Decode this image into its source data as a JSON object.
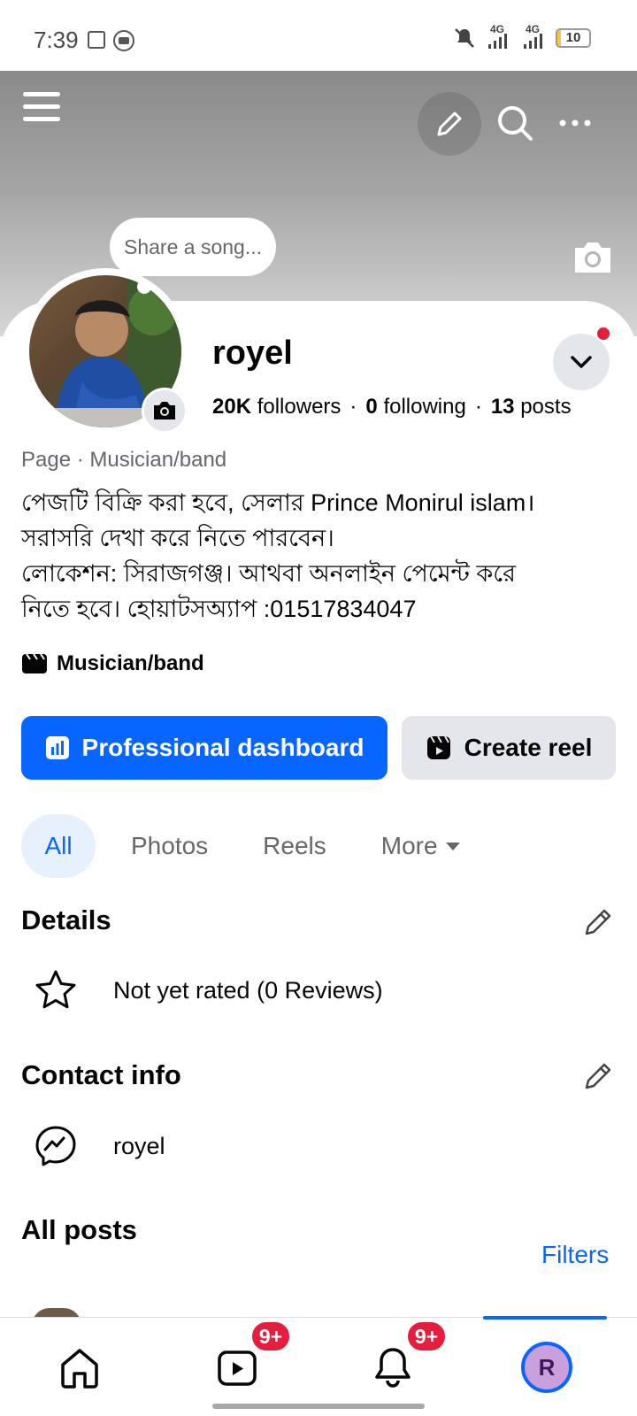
{
  "status_bar": {
    "time": "7:39",
    "network_1": "4G",
    "network_2": "4G",
    "battery_level": "10",
    "battery_percent": 10
  },
  "cover": {
    "song_prompt": "Share a song..."
  },
  "profile": {
    "name": "royel",
    "followers_count": "20K",
    "followers_label": "followers",
    "following_count": "0",
    "following_label": "following",
    "posts_count": "13",
    "posts_label": "posts",
    "stat_separator": "·",
    "page_category_line": "Page · Musician/band",
    "bio_lines": [
      "পেজটি বিক্রি করা হবে, সেলার Prince Monirul islam।",
      "সরাসরি দেখা করে নিতে পারবেন।",
      "লোকেশন: সিরাজগঞ্জ। আথবা অনলাইন পেমেন্ট করে",
      "নিতে হবে। হোয়াটসঅ্যাপ :01517834047"
    ],
    "category": "Musician/band"
  },
  "actions": {
    "primary_label": "Professional dashboard",
    "secondary_label": "Create reel"
  },
  "tabs": [
    "All",
    "Photos",
    "Reels",
    "More"
  ],
  "details": {
    "title": "Details",
    "rating_text": "Not yet rated (0 Reviews)"
  },
  "contact": {
    "title": "Contact info",
    "messenger": "royel"
  },
  "posts": {
    "title": "All posts",
    "filters_label": "Filters"
  },
  "bottom_nav": {
    "video_badge": "9+",
    "notif_badge": "9+",
    "avatar_letter": "R"
  },
  "colors": {
    "accent": "#0866ff",
    "badge": "#e41e3f",
    "secondary_bg": "#e4e6eb",
    "muted_text": "#65676b"
  }
}
